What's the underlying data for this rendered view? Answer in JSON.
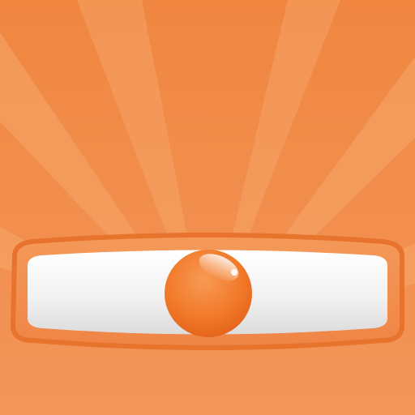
{
  "icon": {
    "name": "level-app-icon",
    "colors": {
      "background": "#f0823c",
      "ray_light": "#f7a86a",
      "ray_lighter": "#f9b47c",
      "vial_frame": "#ee7b35",
      "vial_frame_inner": "#f4a064",
      "vial_fill": "#f7f7f7",
      "vial_shadow": "#d9d9d9",
      "bubble": "#f27c2c",
      "bubble_dark": "#e0641a",
      "bubble_highlight": "#ffffff"
    },
    "bubble_level": 0.5
  }
}
